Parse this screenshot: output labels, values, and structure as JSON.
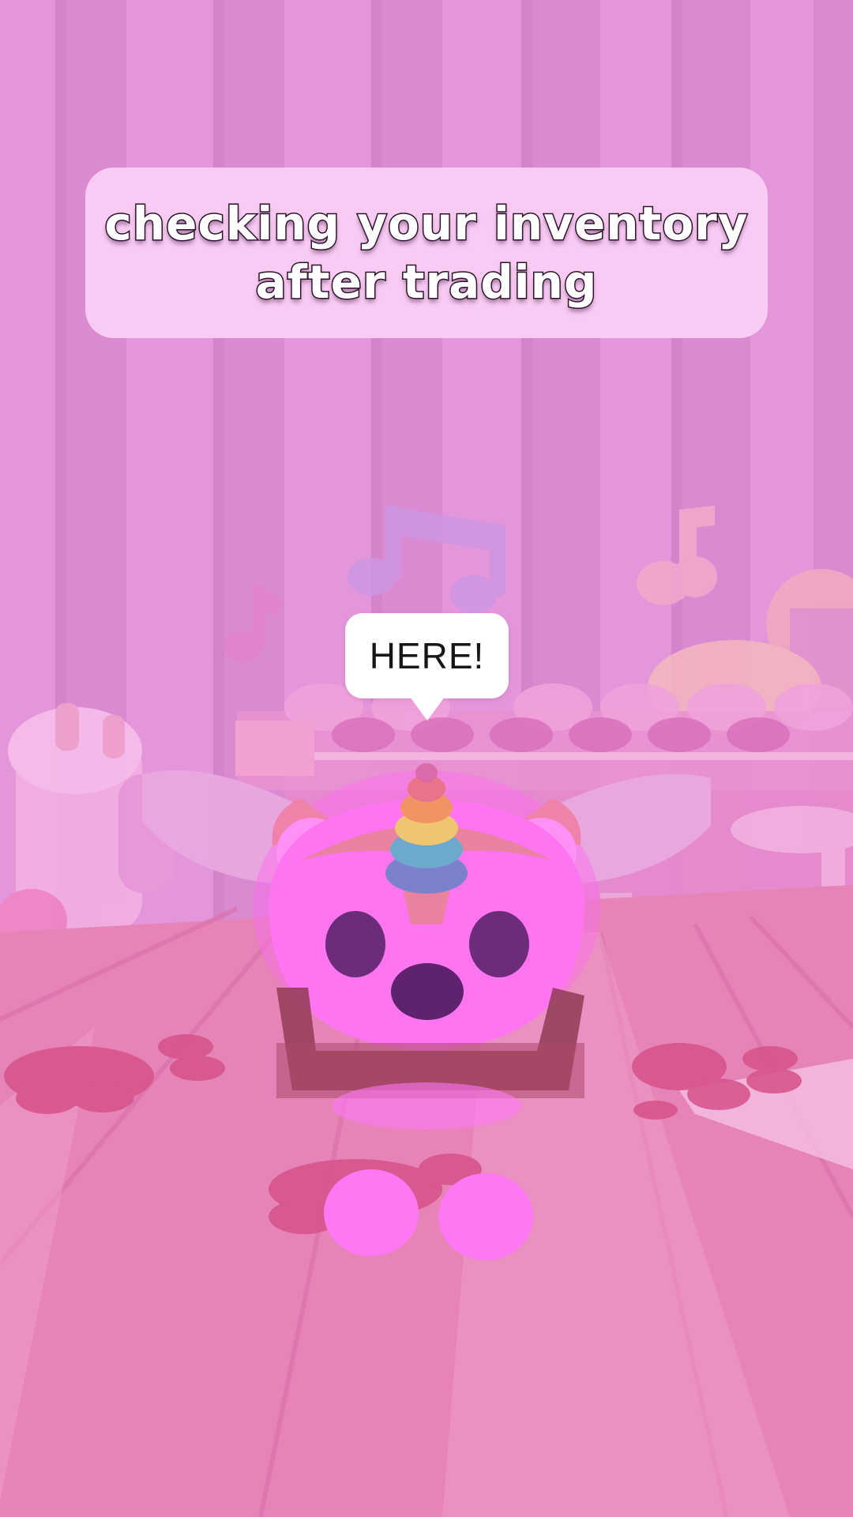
{
  "caption": {
    "line1": "checking your inventory",
    "line2": "after trading"
  },
  "speech_bubble": {
    "text": "HERE!"
  },
  "colors": {
    "wall": "#d880cc",
    "floor": "#e07aae",
    "caption_bg": "#f9caf2",
    "pet_glow": "#ff5cf0",
    "bubble_bg": "#ffffff"
  },
  "icons": [
    "music-note-icon",
    "paw-print-icon",
    "unicorn-horn-icon"
  ]
}
